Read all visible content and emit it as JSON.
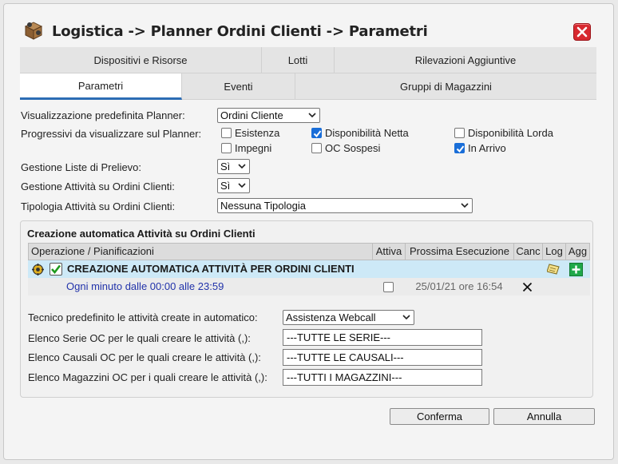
{
  "window": {
    "title": "Logistica -> Planner Ordini Clienti -> Parametri",
    "accent": "#2d6db4",
    "close_color": "#d7282f"
  },
  "tabs_row1": [
    {
      "label": "Dispositivi e Risorse"
    },
    {
      "label": "Lotti"
    },
    {
      "label": "Rilevazioni Aggiuntive"
    }
  ],
  "tabs_row2": [
    {
      "label": "Parametri",
      "active": true
    },
    {
      "label": "Eventi"
    },
    {
      "label": "Gruppi di Magazzini"
    }
  ],
  "form": {
    "planner_view_label": "Visualizzazione predefinita Planner:",
    "planner_view_value": "Ordini Cliente",
    "progressives_label": "Progressivi da visualizzare sul Planner:",
    "progressives": [
      {
        "label": "Esistenza",
        "checked": false
      },
      {
        "label": "Disponibilità Netta",
        "checked": true
      },
      {
        "label": "Disponibilità Lorda",
        "checked": false
      },
      {
        "label": "Impegni",
        "checked": false
      },
      {
        "label": "OC Sospesi",
        "checked": false
      },
      {
        "label": "In Arrivo",
        "checked": true
      }
    ],
    "picking_label": "Gestione Liste di Prelievo:",
    "picking_value": "Sì",
    "activities_label": "Gestione Attività su Ordini Clienti:",
    "activities_value": "Sì",
    "activity_type_label": "Tipologia Attività su Ordini Clienti:",
    "activity_type_value": "Nessuna Tipologia"
  },
  "auto_group": {
    "title": "Creazione automatica Attività su Ordini Clienti",
    "columns": [
      "Operazione / Pianificazioni",
      "Attiva",
      "Prossima Esecuzione",
      "Canc",
      "Log",
      "Agg"
    ],
    "operation": "CREAZIONE AUTOMATICA ATTIVITÀ PER ORDINI CLIENTI",
    "schedule": "Ogni minuto dalle 00:00 alle 23:59",
    "schedule_active": false,
    "next_run": "25/01/21 ore 16:54",
    "schedule_color": "#2233aa",
    "row_highlight": "#cde9f7",
    "tech_label": "Tecnico predefinito le attività create in automatico:",
    "tech_value": "Assistenza Webcall",
    "series_label": "Elenco Serie OC per le quali creare le attività (,):",
    "series_value": "---TUTTE LE SERIE---",
    "causal_label": "Elenco Causali OC per le quali creare le attività (,):",
    "causal_value": "---TUTTE LE CAUSALI---",
    "warehouse_label": "Elenco Magazzini OC per i quali creare le attività (,):",
    "warehouse_value": "---TUTTI I MAGAZZINI---"
  },
  "buttons": {
    "confirm": "Conferma",
    "cancel": "Annulla"
  }
}
